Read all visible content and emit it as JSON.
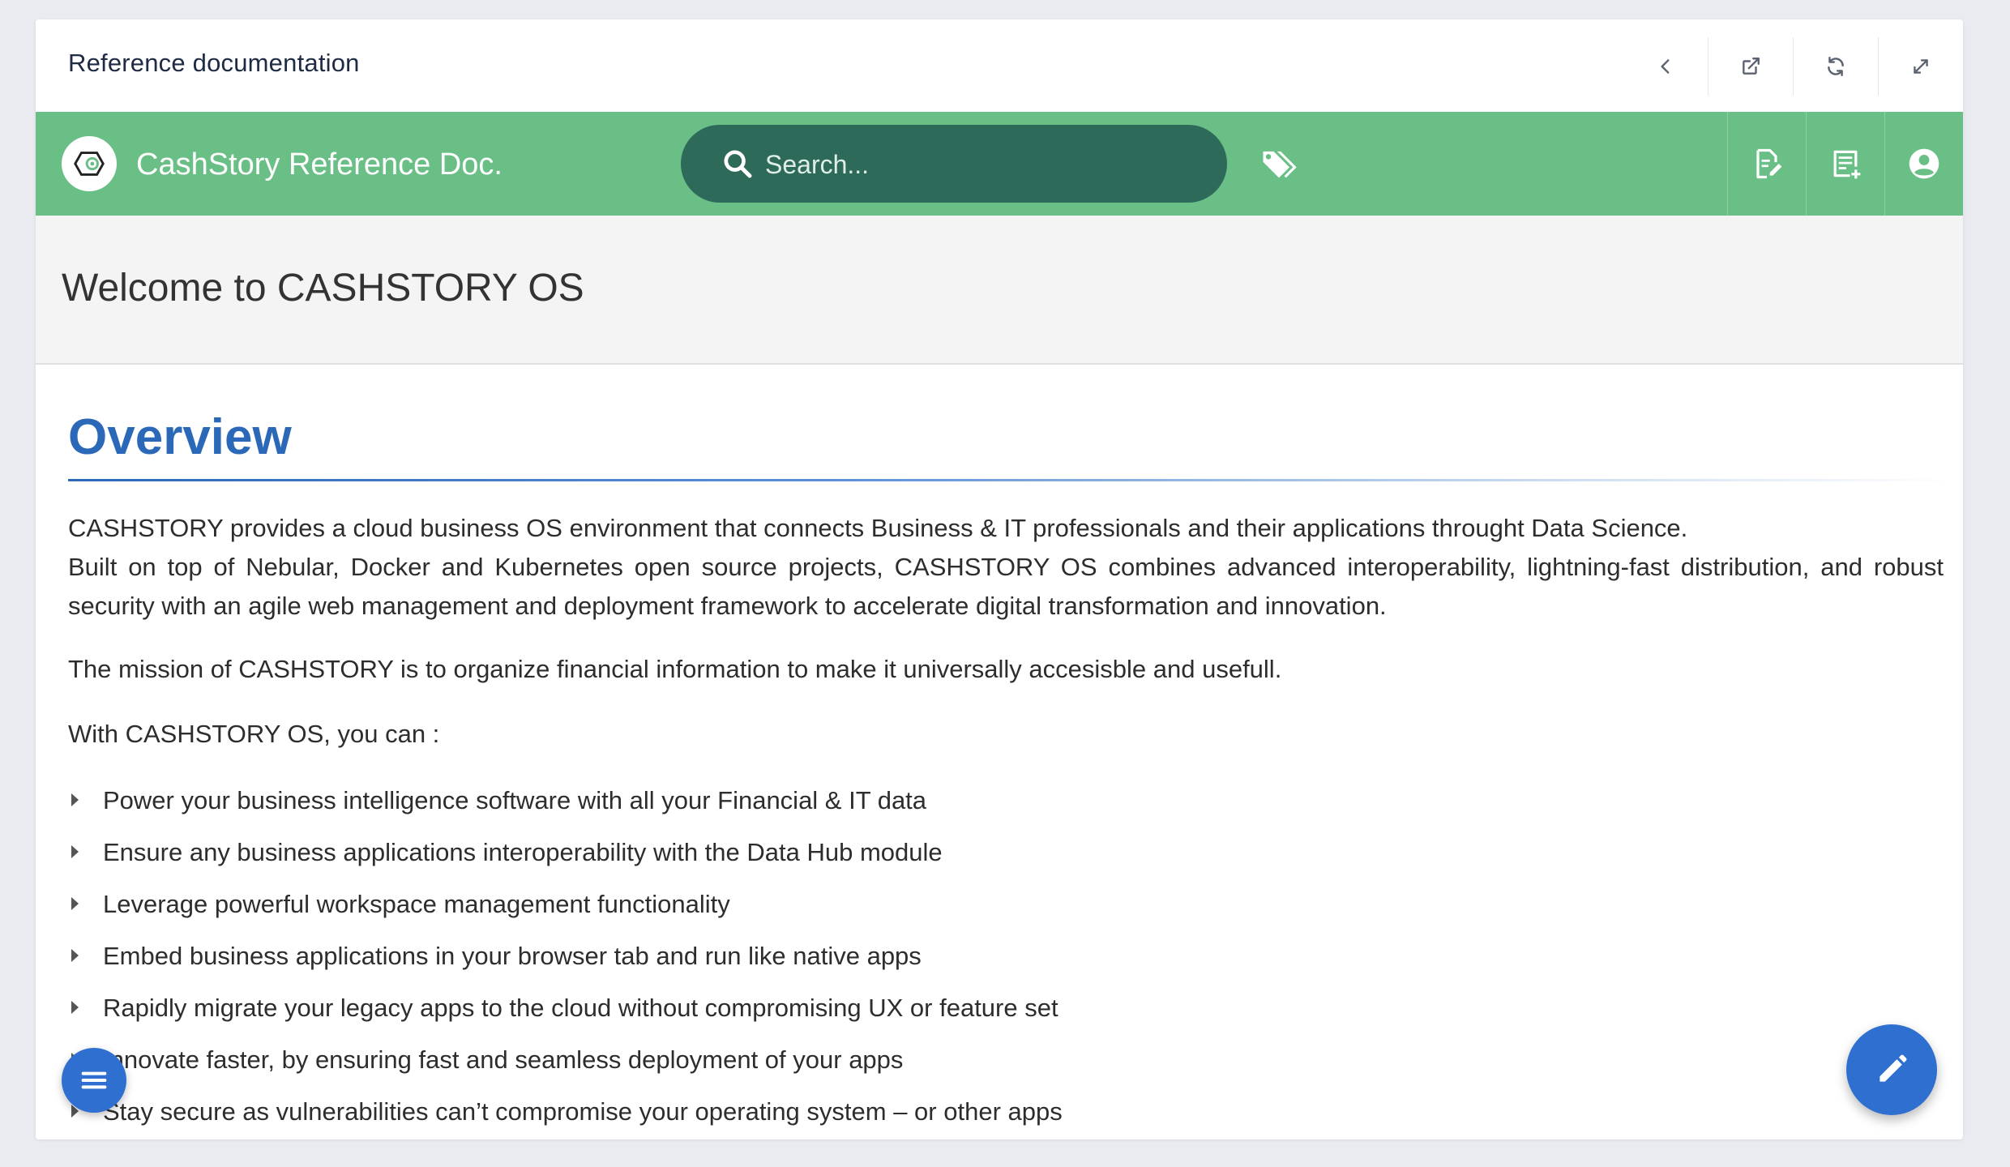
{
  "frame": {
    "title": "Reference documentation",
    "actions": [
      {
        "name": "back",
        "icon": "chevron-left-icon"
      },
      {
        "name": "open-external",
        "icon": "external-link-icon"
      },
      {
        "name": "refresh",
        "icon": "refresh-icon"
      },
      {
        "name": "expand",
        "icon": "expand-icon"
      }
    ]
  },
  "appbar": {
    "app_name": "CashStory Reference Doc.",
    "search_placeholder": "Search...",
    "actions": [
      "edit-document-icon",
      "add-note-icon",
      "account-icon"
    ],
    "accent_color": "#6abf86",
    "search_bg": "#2e6a5a"
  },
  "page": {
    "title": "Welcome to CASHSTORY OS"
  },
  "content": {
    "section_title": "Overview",
    "paragraph1": "CASHSTORY provides a cloud business OS environment that connects Business & IT professionals and their applications throught Data Science.",
    "paragraph1b": "Built on top of Nebular, Docker and Kubernetes open source projects, CASHSTORY OS combines advanced interoperability, lightning-fast distribution, and robust security with an agile web management and deployment framework to accelerate digital transformation and innovation.",
    "paragraph2": "The mission of CASHSTORY is to organize financial information to make it universally accesisble and usefull.",
    "paragraph3": "With CASHSTORY OS, you can :",
    "bullets": [
      "Power your business intelligence software with all your Financial & IT data",
      "Ensure any business applications interoperability with the Data Hub module",
      "Leverage powerful workspace management functionality",
      "Embed business applications in your browser tab and run like native apps",
      "Rapidly migrate your legacy apps to the cloud without compromising UX or feature set",
      "Innovate faster, by ensuring fast and seamless deployment of your apps",
      "Stay secure as vulnerabilities can’t compromise your operating system – or other apps"
    ],
    "title_color": "#2b69b8"
  },
  "fabs": {
    "menu_icon": "menu-icon",
    "edit_icon": "pencil-icon",
    "color": "#2f6fd0"
  }
}
